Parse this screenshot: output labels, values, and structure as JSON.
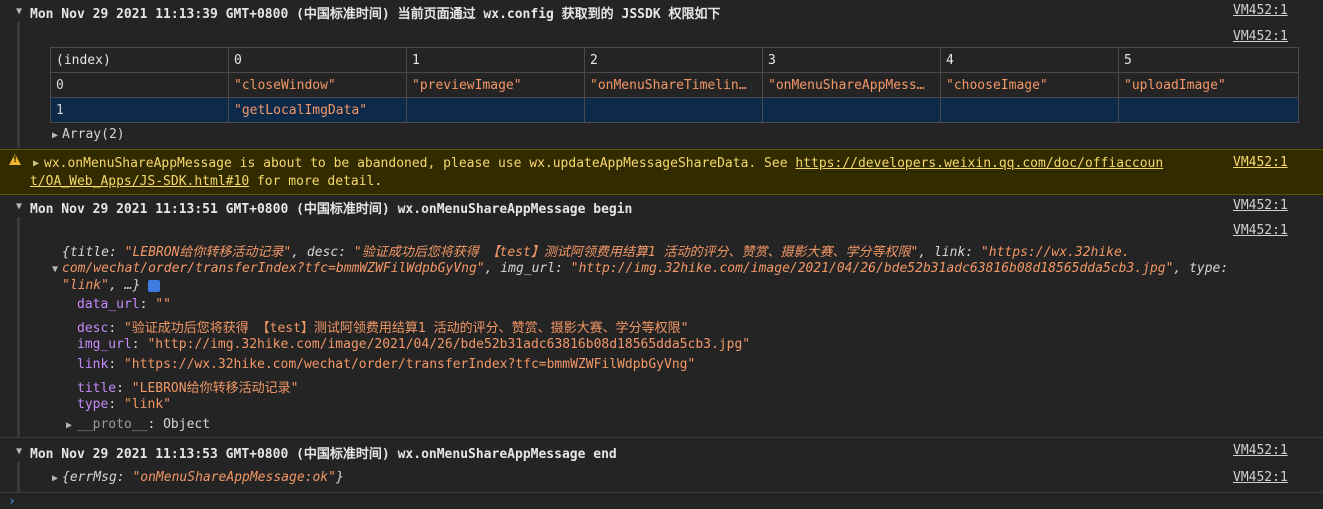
{
  "log1": {
    "header": "Mon Nov 29 2021 11:13:39 GMT+0800 (中国标准时间) 当前页面通过 wx.config 获取到的 JSSDK 权限如下",
    "source": "VM452:1",
    "table_source": "VM452:1",
    "columns": [
      "(index)",
      "0",
      "1",
      "2",
      "3",
      "4",
      "5"
    ],
    "rows": [
      [
        "0",
        "\"closeWindow\"",
        "\"previewImage\"",
        "\"onMenuShareTimelin…",
        "\"onMenuShareAppMess…",
        "\"chooseImage\"",
        "\"uploadImage\""
      ],
      [
        "1",
        "\"getLocalImgData\"",
        "",
        "",
        "",
        "",
        ""
      ]
    ],
    "array_label": "Array(2)"
  },
  "warning": {
    "text": "wx.onMenuShareAppMessage is about to be abandoned, please use wx.updateAppMessageShareData. See ",
    "link_part1": "https://developers.weixin.qq.com/doc/offiaccoun",
    "link_part2": "t/OA_Web_Apps/JS-SDK.html#10",
    "suffix": " for more detail.",
    "source": "VM452:1"
  },
  "log2": {
    "header": "Mon Nov 29 2021 11:13:51 GMT+0800 (中国标准时间) wx.onMenuShareAppMessage begin",
    "source": "VM452:1",
    "preview_line1_title_key": "title",
    "preview_line1_title_val": "\"LEBRON给你转移活动记录\"",
    "preview_line1_desc_key": "desc",
    "preview_line1_desc_val": "\"验证成功后您将获得 【test】测试阿领费用结算1 活动的评分、赞赏、摄影大赛、学分等权限\"",
    "preview_line1_link_key": "link",
    "preview_line1_link_val": "\"https://wx.32hike.",
    "preview_line2_link_val": "com/wechat/order/transferIndex?tfc=bmmWZWFilWdpbGyVng\"",
    "preview_line2_img_key": "img_url",
    "preview_line2_img_val": "\"http://img.32hike.com/image/2021/04/26/bde52b31adc63816b08d18565dda5cb3.jpg\"",
    "preview_line2_type_key": "type",
    "preview_line3_type_val": "\"link\"",
    "preview_ellipsis": ", …}",
    "props": [
      {
        "key": "data_url",
        "value": "\"\""
      },
      {
        "key": "desc",
        "value": "\"验证成功后您将获得 【test】测试阿领费用结算1 活动的评分、赞赏、摄影大赛、学分等权限\""
      },
      {
        "key": "img_url",
        "value": "\"http://img.32hike.com/image/2021/04/26/bde52b31adc63816b08d18565dda5cb3.jpg\""
      },
      {
        "key": "link",
        "value": "\"https://wx.32hike.com/wechat/order/transferIndex?tfc=bmmWZWFilWdpbGyVng\""
      },
      {
        "key": "title",
        "value": "\"LEBRON给你转移活动记录\""
      },
      {
        "key": "type",
        "value": "\"link\""
      }
    ],
    "proto_key": "__proto__",
    "proto_val": "Object",
    "obj_source": "VM452:1"
  },
  "log3": {
    "header": "Mon Nov 29 2021 11:13:53 GMT+0800 (中国标准时间) wx.onMenuShareAppMessage end",
    "source": "VM452:1",
    "obj_key": "errMsg",
    "obj_val": "\"onMenuShareAppMessage:ok\"",
    "obj_source": "VM452:1"
  },
  "colors": {
    "background": "#242424",
    "string": "#f29766",
    "warning_bg": "#332b00",
    "warning_text": "#f4d86a",
    "selected_row": "#0e2a4a"
  },
  "icons": [
    "expand-down-icon",
    "expand-right-icon",
    "warning-icon",
    "info-badge-icon",
    "prompt-icon"
  ]
}
